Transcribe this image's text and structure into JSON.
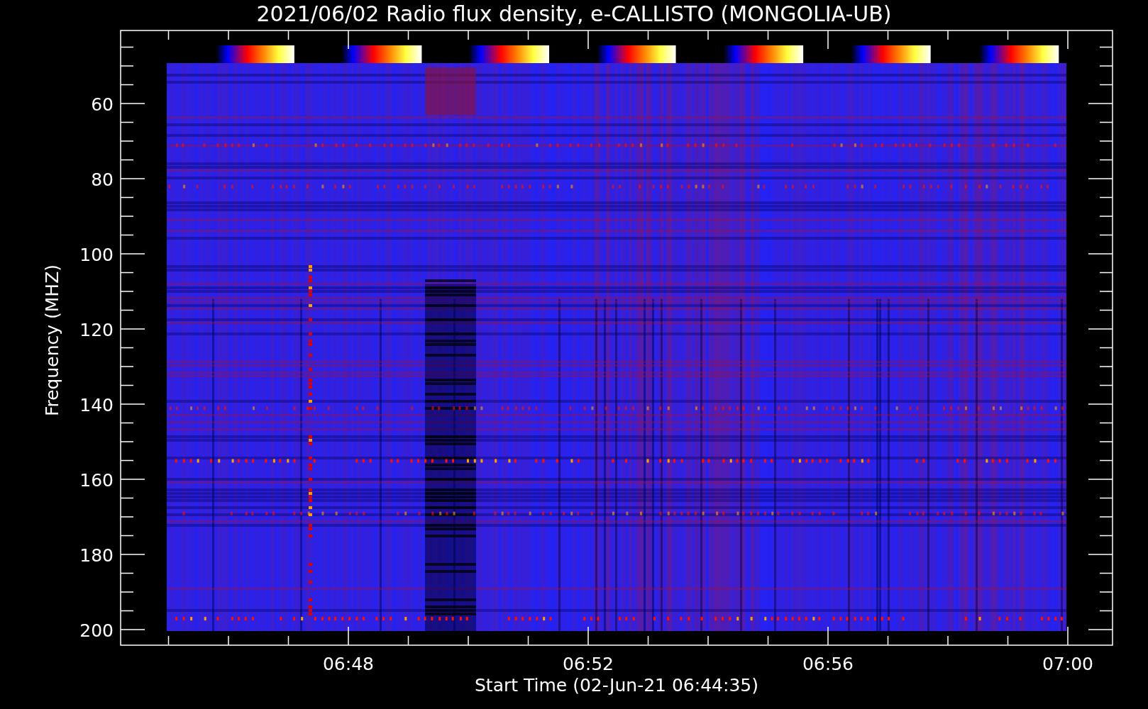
{
  "title": "2021/06/02  Radio flux density, e-CALLISTO (MONGOLIA-UB)",
  "y_axis": {
    "label": "Frequency (MHZ)",
    "ticks": [
      "60",
      "80",
      "100",
      "120",
      "140",
      "160",
      "180",
      "200"
    ]
  },
  "x_axis": {
    "label": "Start Time (02-Jun-21 06:44:35)",
    "ticks": [
      "06:48",
      "06:52",
      "06:56",
      "07:00"
    ]
  }
}
